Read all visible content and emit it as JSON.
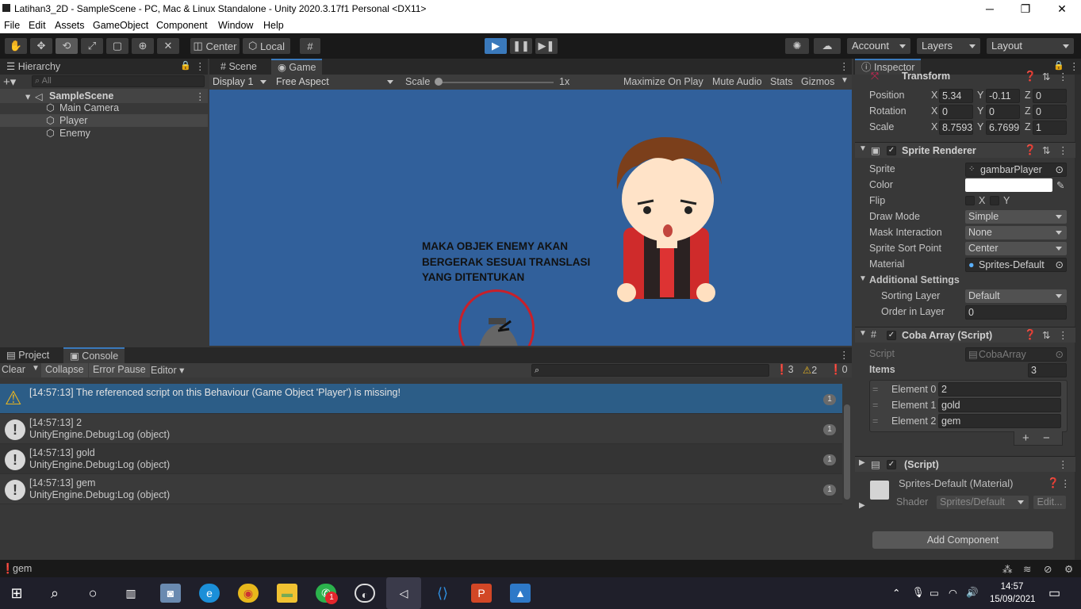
{
  "window": {
    "title": "Latihan3_2D - SampleScene - PC, Mac & Linux Standalone - Unity 2020.3.17f1 Personal <DX11>",
    "minimize": "─",
    "maximize": "❐",
    "close": "✕"
  },
  "menu": [
    "File",
    "Edit",
    "Assets",
    "GameObject",
    "Component",
    "Window",
    "Help"
  ],
  "toolbar": {
    "center": "Center",
    "local": "Local",
    "account": "Account",
    "layers": "Layers",
    "layout": "Layout"
  },
  "hierarchy": {
    "tab": "Hierarchy",
    "search_placeholder": "All",
    "scene": "SampleScene",
    "items": [
      "Main Camera",
      "Player",
      "Enemy"
    ]
  },
  "game_view": {
    "tabs": [
      "Scene",
      "Game"
    ],
    "display": "Display 1",
    "aspect": "Free Aspect",
    "scale_label": "Scale",
    "scale_value": "1x",
    "maximize": "Maximize On Play",
    "mute": "Mute Audio",
    "stats": "Stats",
    "gizmos": "Gizmos",
    "annotation": [
      "MAKA OBJEK ENEMY AKAN",
      "BERGERAK SESUAI TRANSLASI",
      "YANG DITENTUKAN"
    ],
    "bg_color": "#31609b"
  },
  "console": {
    "tabs": [
      "Project",
      "Console"
    ],
    "clear": "Clear",
    "collapse": "Collapse",
    "error_pause": "Error Pause",
    "editor": "Editor",
    "counts": {
      "info": "3",
      "warn": "2",
      "error": "0"
    },
    "entries": [
      {
        "line1": "[14:57:13] The referenced script on this Behaviour (Game Object 'Player') is missing!",
        "line2": "",
        "count": "1"
      },
      {
        "line1": "[14:57:13] 2",
        "line2": "UnityEngine.Debug:Log (object)",
        "count": "1"
      },
      {
        "line1": "[14:57:13] gold",
        "line2": "UnityEngine.Debug:Log (object)",
        "count": "1"
      },
      {
        "line1": "[14:57:13] gem",
        "line2": "UnityEngine.Debug:Log (object)",
        "count": "1"
      }
    ]
  },
  "inspector": {
    "tab": "Inspector",
    "transform": {
      "title": "Transform",
      "position_label": "Position",
      "rotation_label": "Rotation",
      "scale_label": "Scale",
      "pos": [
        "5.34",
        "-0.11",
        "0"
      ],
      "rot": [
        "0",
        "0",
        "0"
      ],
      "scale": [
        "8.7593",
        "6.7699",
        "1"
      ]
    },
    "sprite_renderer": {
      "title": "Sprite Renderer",
      "sprite_label": "Sprite",
      "sprite": "gambarPlayer",
      "color_label": "Color",
      "flip_label": "Flip",
      "draw_mode_label": "Draw Mode",
      "draw_mode": "Simple",
      "mask_label": "Mask Interaction",
      "mask": "None",
      "sort_point_label": "Sprite Sort Point",
      "sort_point": "Center",
      "material_label": "Material",
      "material": "Sprites-Default",
      "additional": "Additional Settings",
      "sorting_layer_label": "Sorting Layer",
      "sorting_layer": "Default",
      "order_label": "Order in Layer",
      "order": "0"
    },
    "coba_array": {
      "title": "Coba Array (Script)",
      "script_label": "Script",
      "script": "CobaArray",
      "items_label": "Items",
      "items_count": "3",
      "elements": [
        {
          "label": "Element 0",
          "value": "2"
        },
        {
          "label": "Element 1",
          "value": "gold"
        },
        {
          "label": "Element 2",
          "value": "gem"
        }
      ]
    },
    "missing_script": "(Script)",
    "material_title": "Sprites-Default (Material)",
    "shader_label": "Shader",
    "shader": "Sprites/Default",
    "edit": "Edit...",
    "add_component": "Add Component"
  },
  "status": {
    "text": "gem"
  },
  "clock": {
    "time": "14:57",
    "date": "15/09/2021"
  },
  "taskbar_badge": "1"
}
